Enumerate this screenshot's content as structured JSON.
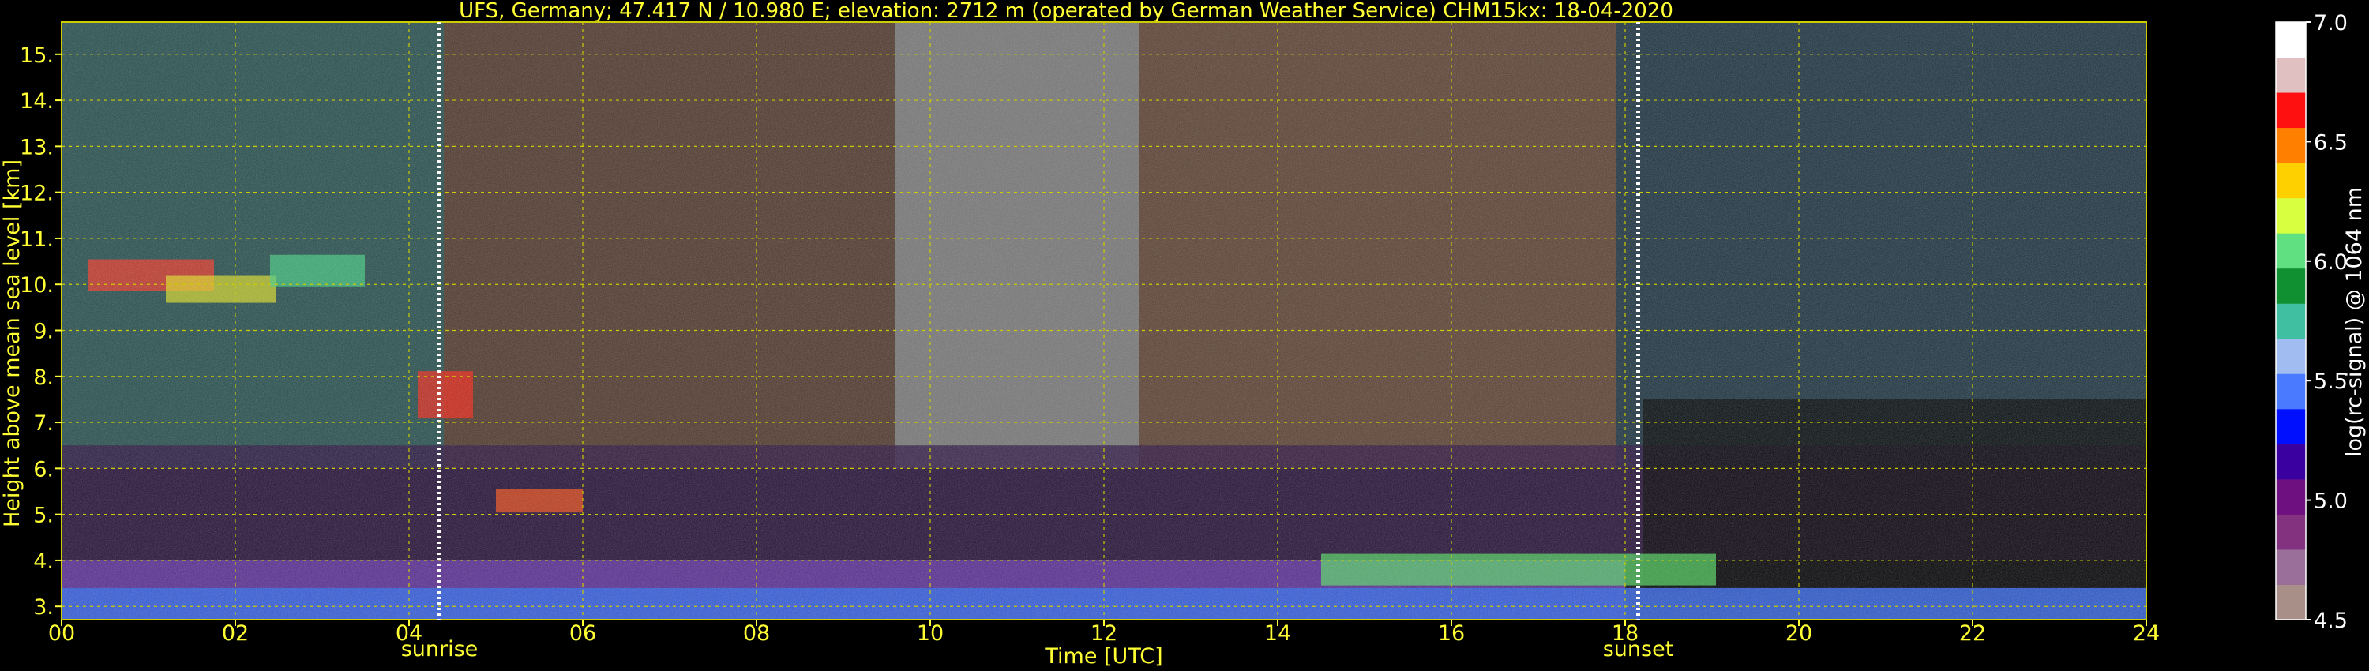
{
  "chart_data": {
    "type": "heatmap",
    "title": "UFS, Germany; 47.417 N / 10.980 E; elevation: 2712 m  (operated by German Weather Service)    CHM15kx: 18-04-2020",
    "xlabel": "Time [UTC]",
    "ylabel": "Height above mean sea level [km]",
    "colorbar_label": "log(rc-signal) @ 1064 nm",
    "xlim": [
      0,
      24
    ],
    "ylim": [
      2.712,
      15.7
    ],
    "x_tick_labels": [
      "00",
      "02",
      "04",
      "06",
      "08",
      "10",
      "12",
      "14",
      "16",
      "18",
      "20",
      "22",
      "24"
    ],
    "x_tick_values": [
      0,
      2,
      4,
      6,
      8,
      10,
      12,
      14,
      16,
      18,
      20,
      22,
      24
    ],
    "y_tick_labels": [
      "3.",
      "4.",
      "5.",
      "6.",
      "7.",
      "8.",
      "9.",
      "10.",
      "11.",
      "12.",
      "13.",
      "14.",
      "15."
    ],
    "y_tick_values": [
      3,
      4,
      5,
      6,
      7,
      8,
      9,
      10,
      11,
      12,
      13,
      14,
      15
    ],
    "colorbar_range": [
      4.5,
      7.0
    ],
    "colorbar_tick_labels": [
      "4.5",
      "5.0",
      "5.5",
      "6.0",
      "6.5",
      "7.0"
    ],
    "colorbar_tick_values": [
      4.5,
      5.0,
      5.5,
      6.0,
      6.5,
      7.0
    ],
    "grid": true,
    "grid_color": "#cccc00",
    "text_color": "#ffff33",
    "annotations": [
      {
        "label": "sunrise",
        "time": 4.35
      },
      {
        "label": "sunset",
        "time": 18.15
      }
    ],
    "colormap": [
      "#a89088",
      "#9a6f9a",
      "#83327f",
      "#6e1080",
      "#3a00a0",
      "#0010ff",
      "#4a7aff",
      "#a0bcf0",
      "#40c0a0",
      "#109030",
      "#60e080",
      "#d8ff40",
      "#ffd000",
      "#ff8000",
      "#ff1010",
      "#e0c0c0",
      "#ffffff"
    ]
  }
}
